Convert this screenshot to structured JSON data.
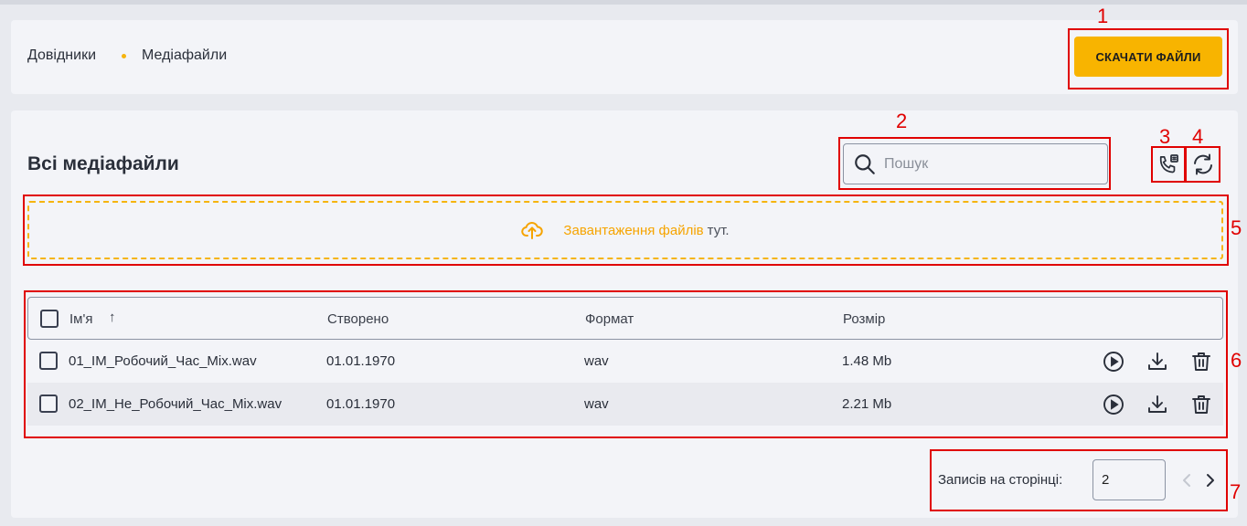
{
  "breadcrumb": {
    "root": "Довідники",
    "current": "Медіафайли"
  },
  "header": {
    "download_all_label": "СКАЧАТИ ФАЙЛИ"
  },
  "section": {
    "title": "Всі медіафайли"
  },
  "search": {
    "placeholder": "Пошук",
    "value": ""
  },
  "icons": {
    "search": "search-icon",
    "call_files": "call-files-icon",
    "refresh": "refresh-icon",
    "upload": "cloud-upload-icon",
    "play": "play-icon",
    "download": "download-icon",
    "delete": "trash-icon"
  },
  "dropzone": {
    "link_text": "Завантаження файлів",
    "tail_text": "тут."
  },
  "table": {
    "columns": {
      "name": "Ім'я",
      "sort_indicator": "↑",
      "created": "Створено",
      "format": "Формат",
      "size": "Розмір"
    },
    "rows": [
      {
        "name": "01_IM_Робочий_Час_Mix.wav",
        "created": "01.01.1970",
        "format": "wav",
        "size": "1.48 Mb"
      },
      {
        "name": "02_IM_Не_Робочий_Час_Mix.wav",
        "created": "01.01.1970",
        "format": "wav",
        "size": "2.21 Mb"
      }
    ]
  },
  "pagination": {
    "per_page_label": "Записів на сторінці:",
    "per_page_value": "2"
  },
  "annotations": [
    "1",
    "2",
    "3",
    "4",
    "5",
    "6",
    "7"
  ],
  "colors": {
    "accent": "#f8b400",
    "annotation": "#e00000",
    "border": "#8b93a3"
  }
}
